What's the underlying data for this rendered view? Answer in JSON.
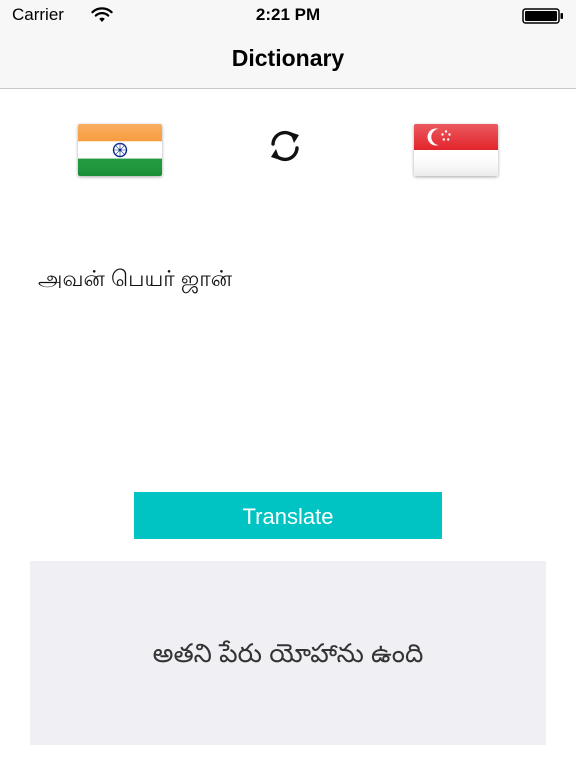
{
  "status_bar": {
    "carrier": "Carrier",
    "time": "2:21 PM",
    "icons": [
      "wifi-icon",
      "battery-icon"
    ]
  },
  "nav": {
    "title": "Dictionary"
  },
  "languages": {
    "source_flag": "india-flag-icon",
    "target_flag": "singapore-flag-icon",
    "swap_icon": "swap-arrows-icon"
  },
  "input": {
    "text": "அவன் பெயர் ஜான்"
  },
  "action": {
    "translate_label": "Translate"
  },
  "output": {
    "text": "అతని పేరు యోహాను ఉంది"
  },
  "colors": {
    "accent": "#00c4c4",
    "result_background": "#efeff4",
    "bar_background": "#f7f7f7"
  }
}
